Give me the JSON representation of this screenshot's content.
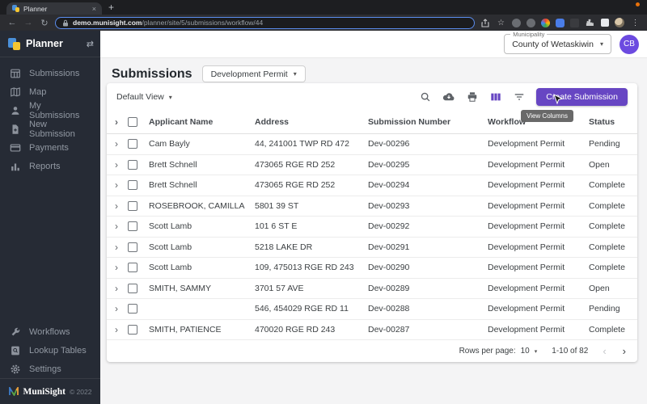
{
  "browser": {
    "tab_title": "Planner",
    "url_host": "demo.munisight.com",
    "url_path": "/planner/site/5/submissions/workflow/44"
  },
  "icons": {
    "back": "←",
    "forward": "→",
    "reload": "↻",
    "star": "☆",
    "menu_dots": "⋮",
    "close_tab": "×",
    "new_tab": "+",
    "collapse": "⇄",
    "caret": "▾",
    "chevron_right": "›",
    "prev": "‹",
    "next": "›"
  },
  "sidebar": {
    "app_name": "Planner",
    "items": [
      {
        "label": "Submissions"
      },
      {
        "label": "Map"
      },
      {
        "label": "My Submissions"
      },
      {
        "label": "New Submission"
      },
      {
        "label": "Payments"
      },
      {
        "label": "Reports"
      }
    ],
    "bottom_items": [
      {
        "label": "Workflows"
      },
      {
        "label": "Lookup Tables"
      },
      {
        "label": "Settings"
      }
    ],
    "footer": {
      "brand": "MuniSight",
      "copyright": "© 2022"
    }
  },
  "header": {
    "municipality_label": "Municipality",
    "municipality_value": "County of Wetaskiwin",
    "avatar_initials": "CB"
  },
  "page": {
    "title": "Submissions",
    "workflow_filter": "Development Permit"
  },
  "toolbar": {
    "view_selector": "Default View",
    "create_button": "Create Submission",
    "tooltip": "View Columns"
  },
  "table": {
    "columns": [
      "Applicant Name",
      "Address",
      "Submission Number",
      "Workflow",
      "Status"
    ],
    "rows": [
      {
        "applicant": "Cam Bayly",
        "address": "44, 241001 TWP RD 472",
        "number": "Dev-00296",
        "workflow": "Development Permit",
        "status": "Pending"
      },
      {
        "applicant": "Brett Schnell",
        "address": "473065 RGE RD 252",
        "number": "Dev-00295",
        "workflow": "Development Permit",
        "status": "Open"
      },
      {
        "applicant": "Brett Schnell",
        "address": "473065 RGE RD 252",
        "number": "Dev-00294",
        "workflow": "Development Permit",
        "status": "Complete"
      },
      {
        "applicant": "ROSEBROOK, CAMILLA",
        "address": "5801 39 ST",
        "number": "Dev-00293",
        "workflow": "Development Permit",
        "status": "Complete"
      },
      {
        "applicant": "Scott Lamb",
        "address": "101 6 ST E",
        "number": "Dev-00292",
        "workflow": "Development Permit",
        "status": "Complete"
      },
      {
        "applicant": "Scott Lamb",
        "address": "5218 LAKE DR",
        "number": "Dev-00291",
        "workflow": "Development Permit",
        "status": "Complete"
      },
      {
        "applicant": "Scott Lamb",
        "address": "109, 475013 RGE RD 243",
        "number": "Dev-00290",
        "workflow": "Development Permit",
        "status": "Complete"
      },
      {
        "applicant": "SMITH, SAMMY",
        "address": "3701 57 AVE",
        "number": "Dev-00289",
        "workflow": "Development Permit",
        "status": "Open"
      },
      {
        "applicant": "",
        "address": "546, 454029 RGE RD 11",
        "number": "Dev-00288",
        "workflow": "Development Permit",
        "status": "Pending"
      },
      {
        "applicant": "SMITH, PATIENCE",
        "address": "470020 RGE RD 243",
        "number": "Dev-00287",
        "workflow": "Development Permit",
        "status": "Complete"
      }
    ]
  },
  "pagination": {
    "rows_per_page_label": "Rows per page:",
    "rows_per_page_value": "10",
    "range": "1-10 of 82"
  },
  "colors": {
    "accent": "#6746c3",
    "avatar": "#6c4be0",
    "sidebar_bg": "#262b35"
  }
}
